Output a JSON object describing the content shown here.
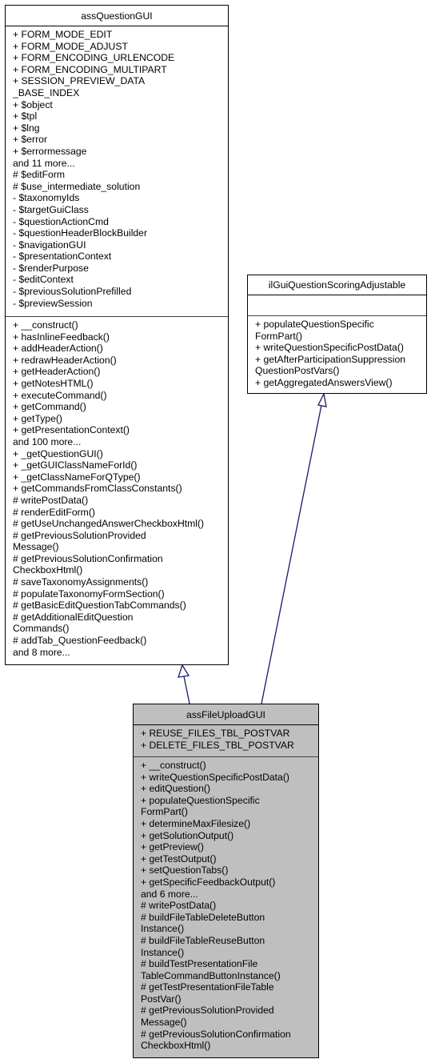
{
  "classes": {
    "base": {
      "name": "assQuestionGUI",
      "attributes": [
        "+ FORM_MODE_EDIT",
        "+ FORM_MODE_ADJUST",
        "+ FORM_ENCODING_URLENCODE",
        "+ FORM_ENCODING_MULTIPART",
        "+ SESSION_PREVIEW_DATA",
        "_BASE_INDEX",
        "+ $object",
        "+ $tpl",
        "+ $lng",
        "+ $error",
        "+ $errormessage",
        "and 11 more...",
        "# $editForm",
        "# $use_intermediate_solution",
        "- $taxonomyIds",
        "- $targetGuiClass",
        "- $questionActionCmd",
        "- $questionHeaderBlockBuilder",
        "- $navigationGUI",
        "- $presentationContext",
        "- $renderPurpose",
        "- $editContext",
        "- $previousSolutionPrefilled",
        "- $previewSession"
      ],
      "methods": [
        "+ __construct()",
        "+ hasInlineFeedback()",
        "+ addHeaderAction()",
        "+ redrawHeaderAction()",
        "+ getHeaderAction()",
        "+ getNotesHTML()",
        "+ executeCommand()",
        "+ getCommand()",
        "+ getType()",
        "+ getPresentationContext()",
        "and 100 more...",
        "+ _getQuestionGUI()",
        "+ _getGUIClassNameForId()",
        "+ _getClassNameForQType()",
        "+ getCommandsFromClassConstants()",
        "# writePostData()",
        "# renderEditForm()",
        "# getUseUnchangedAnswerCheckboxHtml()",
        "# getPreviousSolutionProvided",
        "Message()",
        "# getPreviousSolutionConfirmation",
        "CheckboxHtml()",
        "# saveTaxonomyAssignments()",
        "# populateTaxonomyFormSection()",
        "# getBasicEditQuestionTabCommands()",
        "# getAdditionalEditQuestion",
        "Commands()",
        "# addTab_QuestionFeedback()",
        "and 8 more..."
      ]
    },
    "interface": {
      "name": "ilGuiQuestionScoringAdjustable",
      "attributes": [],
      "methods": [
        "+ populateQuestionSpecific",
        "FormPart()",
        "+ writeQuestionSpecificPostData()",
        "+ getAfterParticipationSuppression",
        "QuestionPostVars()",
        "+ getAggregatedAnswersView()"
      ]
    },
    "derived": {
      "name": "assFileUploadGUI",
      "attributes": [
        "+ REUSE_FILES_TBL_POSTVAR",
        "+ DELETE_FILES_TBL_POSTVAR"
      ],
      "methods": [
        "+ __construct()",
        "+ writeQuestionSpecificPostData()",
        "+ editQuestion()",
        "+ populateQuestionSpecific",
        "FormPart()",
        "+ determineMaxFilesize()",
        "+ getSolutionOutput()",
        "+ getPreview()",
        "+ getTestOutput()",
        "+ setQuestionTabs()",
        "+ getSpecificFeedbackOutput()",
        "and 6 more...",
        "# writePostData()",
        "# buildFileTableDeleteButton",
        "Instance()",
        "# buildFileTableReuseButton",
        "Instance()",
        "# buildTestPresentationFile",
        "TableCommandButtonInstance()",
        "# getTestPresentationFileTable",
        "PostVar()",
        "# getPreviousSolutionProvided",
        "Message()",
        "# getPreviousSolutionConfirmation",
        "CheckboxHtml()"
      ]
    }
  },
  "relations": [
    {
      "from": "assFileUploadGUI",
      "to": "assQuestionGUI",
      "type": "inheritance"
    },
    {
      "from": "assFileUploadGUI",
      "to": "ilGuiQuestionScoringAdjustable",
      "type": "inheritance"
    }
  ],
  "colors": {
    "edge": "#191970",
    "highlight_fill": "#bfbfbf",
    "border": "#000000"
  }
}
